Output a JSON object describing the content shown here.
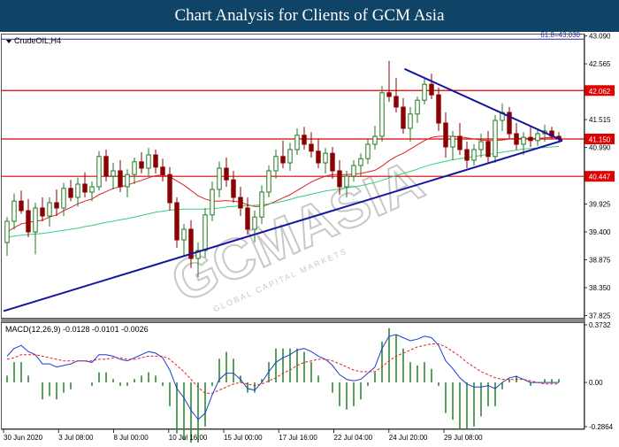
{
  "header": {
    "title": "Chart Analysis for Clients of GCM Asia"
  },
  "symbol": "CrudeOIL,H4",
  "watermark": {
    "main": "GCMASIA",
    "sub": "GLOBAL CAPITAL MARKETS"
  },
  "colors": {
    "header_bg": "#0f4466",
    "bull_candle": "#1f7a1f",
    "bear_candle": "#8b0000",
    "ma_fast": "#e02020",
    "ma_slow": "#35d07a",
    "trendline": "#1515a0",
    "horizontal_level": "#e00000",
    "fib_level": "#2a2aa0",
    "macd_line": "#1a3fd0",
    "macd_signal": "#e02020",
    "macd_hist": "#2e8b2e",
    "level_label_bg": "#e00000"
  },
  "chart_data": [
    {
      "type": "candlestick",
      "title": "",
      "symbol": "CrudeOIL,H4",
      "price_axis": {
        "ylim": [
          37.8,
          43.1
        ],
        "ticks": [
          "43.090",
          "42.565",
          "42.062",
          "41.515",
          "41.150",
          "40.990",
          "40.447",
          "39.925",
          "39.400",
          "38.875",
          "38.350",
          "37.825"
        ]
      },
      "time_axis": {
        "labels": [
          "30 Jun 2020",
          "3 Jul 08:00",
          "8 Jul 00:00",
          "10 Jul 16:00",
          "15 Jul 00:00",
          "17 Jul 16:00",
          "22 Jul 04:00",
          "24 Jul 20:00",
          "29 Jul 08:00"
        ]
      },
      "levels": [
        {
          "label": "61.8=43.030",
          "value": 43.03,
          "kind": "fibonacci"
        },
        {
          "label": "42.062",
          "value": 42.062,
          "kind": "resistance"
        },
        {
          "label": "41.150",
          "value": 41.15,
          "kind": "pivot"
        },
        {
          "label": "40.447",
          "value": 40.447,
          "kind": "support"
        }
      ],
      "trendlines": [
        {
          "name": "upper",
          "from": {
            "x": "22 Jul 00:00",
            "y": 42.47
          },
          "to": {
            "x": "30 Jul 16:00",
            "y": 41.12
          }
        },
        {
          "name": "lower",
          "from": {
            "x": "30 Jun 00:00",
            "y": 37.91
          },
          "to": {
            "x": "30 Jul 16:00",
            "y": 41.12
          }
        }
      ],
      "candles": [
        {
          "o": 39.2,
          "h": 39.68,
          "l": 38.95,
          "c": 39.6
        },
        {
          "o": 39.6,
          "h": 40.12,
          "l": 39.45,
          "c": 39.98
        },
        {
          "o": 39.98,
          "h": 40.18,
          "l": 39.74,
          "c": 39.8
        },
        {
          "o": 39.8,
          "h": 40.02,
          "l": 39.3,
          "c": 39.4
        },
        {
          "o": 39.4,
          "h": 39.95,
          "l": 38.98,
          "c": 39.85
        },
        {
          "o": 39.85,
          "h": 40.05,
          "l": 39.6,
          "c": 39.7
        },
        {
          "o": 39.7,
          "h": 40.05,
          "l": 39.5,
          "c": 39.95
        },
        {
          "o": 39.95,
          "h": 40.2,
          "l": 39.7,
          "c": 39.85
        },
        {
          "o": 39.85,
          "h": 40.32,
          "l": 39.7,
          "c": 40.22
        },
        {
          "o": 40.22,
          "h": 40.38,
          "l": 39.98,
          "c": 40.05
        },
        {
          "o": 40.05,
          "h": 40.42,
          "l": 39.88,
          "c": 40.3
        },
        {
          "o": 40.3,
          "h": 40.52,
          "l": 40.05,
          "c": 40.15
        },
        {
          "o": 40.15,
          "h": 40.35,
          "l": 39.98,
          "c": 40.25
        },
        {
          "o": 40.25,
          "h": 40.92,
          "l": 40.18,
          "c": 40.82
        },
        {
          "o": 40.82,
          "h": 40.95,
          "l": 40.35,
          "c": 40.45
        },
        {
          "o": 40.45,
          "h": 40.7,
          "l": 40.2,
          "c": 40.55
        },
        {
          "o": 40.55,
          "h": 40.75,
          "l": 40.15,
          "c": 40.25
        },
        {
          "o": 40.25,
          "h": 40.58,
          "l": 40.05,
          "c": 40.48
        },
        {
          "o": 40.48,
          "h": 40.8,
          "l": 40.3,
          "c": 40.72
        },
        {
          "o": 40.72,
          "h": 40.9,
          "l": 40.5,
          "c": 40.6
        },
        {
          "o": 40.6,
          "h": 40.98,
          "l": 40.45,
          "c": 40.85
        },
        {
          "o": 40.85,
          "h": 40.95,
          "l": 40.5,
          "c": 40.62
        },
        {
          "o": 40.62,
          "h": 40.78,
          "l": 40.35,
          "c": 40.48
        },
        {
          "o": 40.48,
          "h": 40.62,
          "l": 39.8,
          "c": 39.95
        },
        {
          "o": 39.95,
          "h": 40.05,
          "l": 39.1,
          "c": 39.25
        },
        {
          "o": 39.25,
          "h": 39.55,
          "l": 38.95,
          "c": 39.45
        },
        {
          "o": 39.45,
          "h": 39.62,
          "l": 38.72,
          "c": 38.9
        },
        {
          "o": 38.9,
          "h": 39.2,
          "l": 38.55,
          "c": 39.05
        },
        {
          "o": 39.05,
          "h": 39.85,
          "l": 38.92,
          "c": 39.72
        },
        {
          "o": 39.72,
          "h": 40.35,
          "l": 39.6,
          "c": 40.2
        },
        {
          "o": 40.2,
          "h": 40.72,
          "l": 40.05,
          "c": 40.6
        },
        {
          "o": 40.6,
          "h": 40.8,
          "l": 40.25,
          "c": 40.38
        },
        {
          "o": 40.38,
          "h": 40.55,
          "l": 39.95,
          "c": 40.05
        },
        {
          "o": 40.05,
          "h": 40.25,
          "l": 39.7,
          "c": 39.85
        },
        {
          "o": 39.85,
          "h": 40.05,
          "l": 39.35,
          "c": 39.45
        },
        {
          "o": 39.45,
          "h": 39.8,
          "l": 39.2,
          "c": 39.68
        },
        {
          "o": 39.68,
          "h": 40.28,
          "l": 39.55,
          "c": 40.15
        },
        {
          "o": 40.15,
          "h": 40.65,
          "l": 40.05,
          "c": 40.55
        },
        {
          "o": 40.55,
          "h": 40.95,
          "l": 40.4,
          "c": 40.82
        },
        {
          "o": 40.82,
          "h": 41.12,
          "l": 40.6,
          "c": 40.7
        },
        {
          "o": 40.7,
          "h": 41.08,
          "l": 40.55,
          "c": 40.95
        },
        {
          "o": 40.95,
          "h": 41.35,
          "l": 40.85,
          "c": 41.22
        },
        {
          "o": 41.22,
          "h": 41.38,
          "l": 40.95,
          "c": 41.05
        },
        {
          "o": 41.05,
          "h": 41.28,
          "l": 40.8,
          "c": 40.92
        },
        {
          "o": 40.92,
          "h": 41.15,
          "l": 40.6,
          "c": 40.7
        },
        {
          "o": 40.7,
          "h": 40.98,
          "l": 40.5,
          "c": 40.88
        },
        {
          "o": 40.88,
          "h": 41.0,
          "l": 40.4,
          "c": 40.55
        },
        {
          "o": 40.55,
          "h": 40.75,
          "l": 40.1,
          "c": 40.25
        },
        {
          "o": 40.25,
          "h": 40.55,
          "l": 40.05,
          "c": 40.45
        },
        {
          "o": 40.45,
          "h": 40.75,
          "l": 40.35,
          "c": 40.65
        },
        {
          "o": 40.65,
          "h": 40.88,
          "l": 40.45,
          "c": 40.78
        },
        {
          "o": 40.78,
          "h": 41.15,
          "l": 40.68,
          "c": 41.05
        },
        {
          "o": 41.05,
          "h": 41.4,
          "l": 40.95,
          "c": 41.2
        },
        {
          "o": 41.2,
          "h": 42.15,
          "l": 41.1,
          "c": 42.02
        },
        {
          "o": 42.02,
          "h": 42.62,
          "l": 41.85,
          "c": 41.95
        },
        {
          "o": 41.95,
          "h": 42.3,
          "l": 41.65,
          "c": 41.75
        },
        {
          "o": 41.75,
          "h": 41.92,
          "l": 41.25,
          "c": 41.35
        },
        {
          "o": 41.35,
          "h": 41.75,
          "l": 41.1,
          "c": 41.62
        },
        {
          "o": 41.62,
          "h": 41.95,
          "l": 41.45,
          "c": 41.88
        },
        {
          "o": 41.88,
          "h": 42.28,
          "l": 41.8,
          "c": 42.18
        },
        {
          "o": 42.18,
          "h": 42.38,
          "l": 41.9,
          "c": 41.98
        },
        {
          "o": 41.98,
          "h": 42.12,
          "l": 41.3,
          "c": 41.45
        },
        {
          "o": 41.45,
          "h": 41.65,
          "l": 40.8,
          "c": 41.0
        },
        {
          "o": 41.0,
          "h": 41.3,
          "l": 40.75,
          "c": 41.2
        },
        {
          "o": 41.2,
          "h": 41.45,
          "l": 40.85,
          "c": 40.95
        },
        {
          "o": 40.95,
          "h": 41.1,
          "l": 40.6,
          "c": 40.75
        },
        {
          "o": 40.75,
          "h": 41.05,
          "l": 40.65,
          "c": 40.95
        },
        {
          "o": 40.95,
          "h": 41.25,
          "l": 40.8,
          "c": 41.1
        },
        {
          "o": 41.1,
          "h": 41.3,
          "l": 40.7,
          "c": 40.82
        },
        {
          "o": 40.82,
          "h": 41.6,
          "l": 40.7,
          "c": 41.5
        },
        {
          "o": 41.5,
          "h": 41.82,
          "l": 41.3,
          "c": 41.65
        },
        {
          "o": 41.65,
          "h": 41.75,
          "l": 41.15,
          "c": 41.25
        },
        {
          "o": 41.25,
          "h": 41.45,
          "l": 40.95,
          "c": 41.05
        },
        {
          "o": 41.05,
          "h": 41.28,
          "l": 40.85,
          "c": 41.18
        },
        {
          "o": 41.18,
          "h": 41.4,
          "l": 41.0,
          "c": 41.12
        },
        {
          "o": 41.12,
          "h": 41.35,
          "l": 41.02,
          "c": 41.25
        },
        {
          "o": 41.25,
          "h": 41.42,
          "l": 41.1,
          "c": 41.3
        },
        {
          "o": 41.3,
          "h": 41.38,
          "l": 41.15,
          "c": 41.2
        },
        {
          "o": 41.2,
          "h": 41.28,
          "l": 41.08,
          "c": 41.15
        }
      ],
      "moving_averages": [
        {
          "name": "fast",
          "values": [
            39.4,
            39.48,
            39.55,
            39.58,
            39.6,
            39.62,
            39.68,
            39.72,
            39.8,
            39.86,
            39.93,
            39.98,
            40.02,
            40.1,
            40.16,
            40.22,
            40.25,
            40.28,
            40.33,
            40.37,
            40.42,
            40.46,
            40.47,
            40.44,
            40.36,
            40.28,
            40.18,
            40.08,
            40.02,
            39.98,
            39.98,
            39.99,
            39.98,
            39.96,
            39.91,
            39.88,
            39.88,
            39.92,
            39.98,
            40.04,
            40.1,
            40.18,
            40.26,
            40.34,
            40.4,
            40.45,
            40.48,
            40.48,
            40.48,
            40.49,
            40.5,
            40.53,
            40.56,
            40.64,
            40.74,
            40.82,
            40.88,
            40.96,
            41.04,
            41.12,
            41.18,
            41.2,
            41.2,
            41.2,
            41.19,
            41.17,
            41.15,
            41.13,
            41.12,
            41.12,
            41.13,
            41.15,
            41.16,
            41.16,
            41.16,
            41.16,
            41.17,
            41.18,
            41.18
          ]
        },
        {
          "name": "slow",
          "values": [
            39.3,
            39.32,
            39.34,
            39.35,
            39.36,
            39.37,
            39.39,
            39.41,
            39.43,
            39.45,
            39.47,
            39.5,
            39.52,
            39.55,
            39.58,
            39.6,
            39.63,
            39.65,
            39.68,
            39.71,
            39.74,
            39.77,
            39.79,
            39.81,
            39.82,
            39.83,
            39.83,
            39.83,
            39.83,
            39.84,
            39.85,
            39.87,
            39.88,
            39.89,
            39.89,
            39.9,
            39.91,
            39.93,
            39.95,
            39.98,
            40.01,
            40.05,
            40.08,
            40.11,
            40.14,
            40.17,
            40.19,
            40.21,
            40.23,
            40.25,
            40.27,
            40.3,
            40.33,
            40.37,
            40.42,
            40.46,
            40.5,
            40.54,
            40.58,
            40.63,
            40.67,
            40.7,
            40.73,
            40.76,
            40.78,
            40.8,
            40.82,
            40.84,
            40.86,
            40.88,
            40.9,
            40.92,
            40.94,
            40.96,
            40.97,
            40.98,
            40.99,
            41.0,
            41.01
          ]
        }
      ]
    },
    {
      "type": "macd",
      "label": "MACD(12,26,9) -0.0128 -0.0101 -0.0026",
      "ylim": [
        -0.2864,
        0.3732
      ],
      "ticks": [
        "0.3732",
        "0.00",
        "-0.2864"
      ],
      "macd": [
        0.17,
        0.22,
        0.24,
        0.2,
        0.18,
        0.12,
        0.12,
        0.1,
        0.11,
        0.12,
        0.14,
        0.14,
        0.13,
        0.18,
        0.18,
        0.17,
        0.15,
        0.14,
        0.16,
        0.18,
        0.2,
        0.19,
        0.16,
        0.08,
        -0.04,
        -0.1,
        -0.18,
        -0.24,
        -0.2,
        -0.08,
        0.02,
        0.06,
        0.06,
        0.02,
        -0.04,
        -0.05,
        0.0,
        0.07,
        0.13,
        0.16,
        0.18,
        0.21,
        0.22,
        0.2,
        0.17,
        0.15,
        0.11,
        0.05,
        0.02,
        0.01,
        0.02,
        0.06,
        0.1,
        0.22,
        0.3,
        0.31,
        0.29,
        0.27,
        0.28,
        0.3,
        0.29,
        0.24,
        0.14,
        0.09,
        0.03,
        -0.01,
        -0.03,
        -0.03,
        -0.02,
        -0.04,
        0.0,
        0.03,
        0.04,
        0.02,
        0.0,
        0.0,
        0.0,
        0.0,
        0.0
      ],
      "signal": [
        0.15,
        0.16,
        0.18,
        0.18,
        0.18,
        0.17,
        0.16,
        0.15,
        0.14,
        0.14,
        0.14,
        0.14,
        0.14,
        0.15,
        0.15,
        0.16,
        0.16,
        0.15,
        0.15,
        0.16,
        0.17,
        0.17,
        0.17,
        0.15,
        0.11,
        0.07,
        0.02,
        -0.03,
        -0.07,
        -0.07,
        -0.05,
        -0.03,
        -0.01,
        0.0,
        -0.01,
        -0.02,
        -0.01,
        0.01,
        0.03,
        0.06,
        0.08,
        0.11,
        0.13,
        0.14,
        0.15,
        0.15,
        0.14,
        0.12,
        0.1,
        0.08,
        0.07,
        0.07,
        0.07,
        0.1,
        0.14,
        0.17,
        0.19,
        0.21,
        0.23,
        0.24,
        0.25,
        0.25,
        0.23,
        0.2,
        0.17,
        0.13,
        0.1,
        0.07,
        0.05,
        0.03,
        0.02,
        0.02,
        0.02,
        0.02,
        0.01,
        0.0,
        -0.01,
        -0.01,
        -0.01
      ]
    }
  ]
}
